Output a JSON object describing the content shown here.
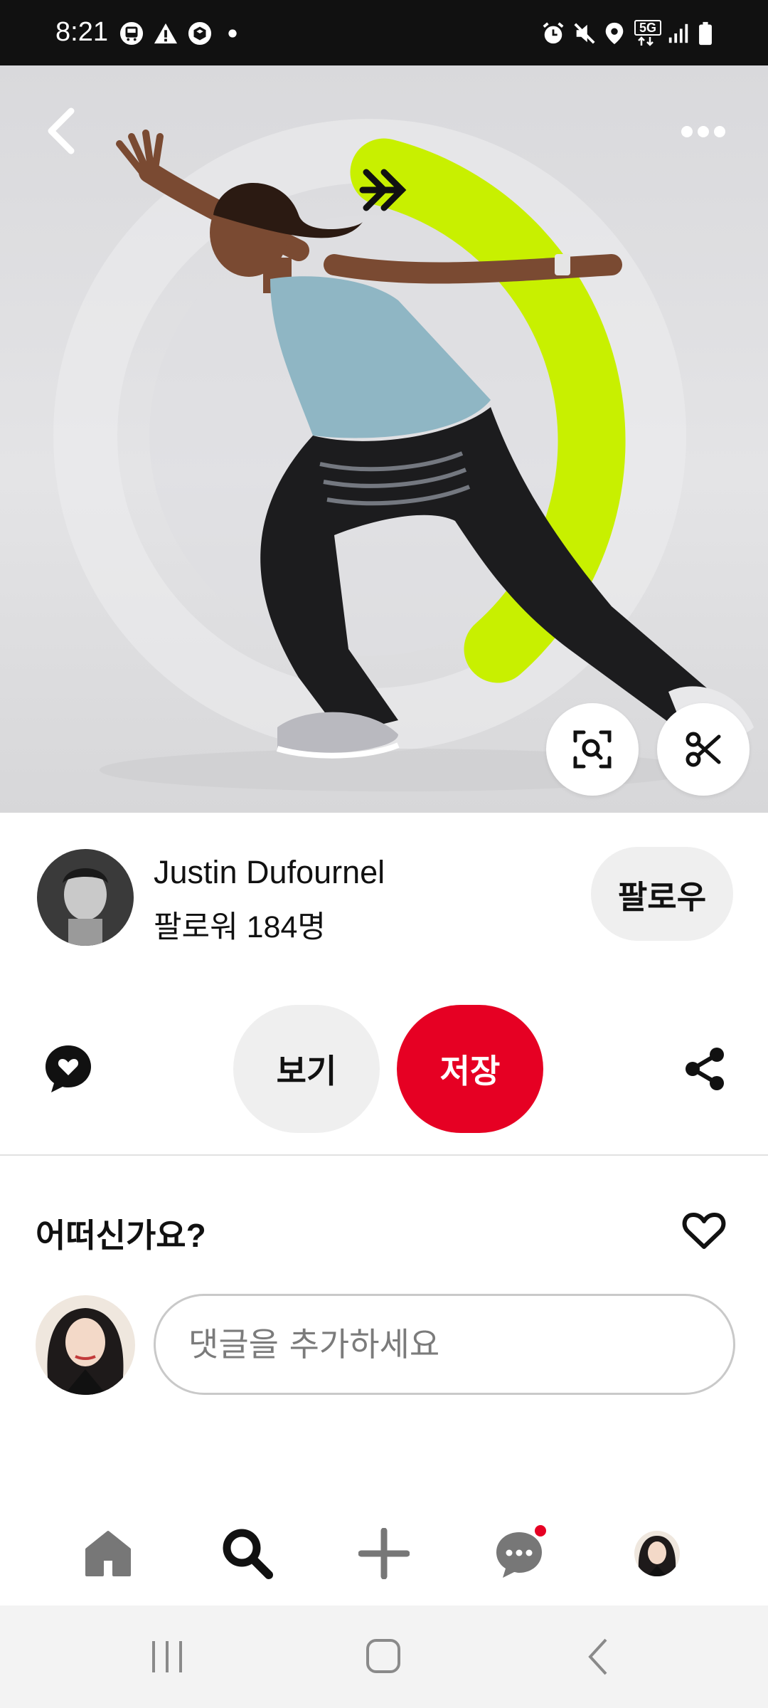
{
  "status_bar": {
    "time": "8:21",
    "left_icons": [
      "bus-icon",
      "warning-icon",
      "package-icon",
      "dot-icon"
    ],
    "right_icons": [
      "alarm-icon",
      "mute-icon",
      "location-icon",
      "5g-icon",
      "signal-icon",
      "battery-icon"
    ],
    "network_label": "5G"
  },
  "pin": {
    "author_name": "Justin Dufournel",
    "followers": "팔로워 184명",
    "follow_label": "팔로우"
  },
  "actions": {
    "view_label": "보기",
    "save_label": "저장"
  },
  "comments": {
    "heading": "어떠신가요?",
    "input_placeholder": "댓글을 추가하세요"
  },
  "colors": {
    "save_red": "#e60023",
    "accent_green": "#c8f000",
    "notification_dot": "#e60023"
  },
  "bottom_nav": [
    "home-icon",
    "search-icon",
    "add-icon",
    "messages-icon",
    "profile-avatar"
  ],
  "system_nav": [
    "recents-button",
    "home-button",
    "back-button"
  ]
}
